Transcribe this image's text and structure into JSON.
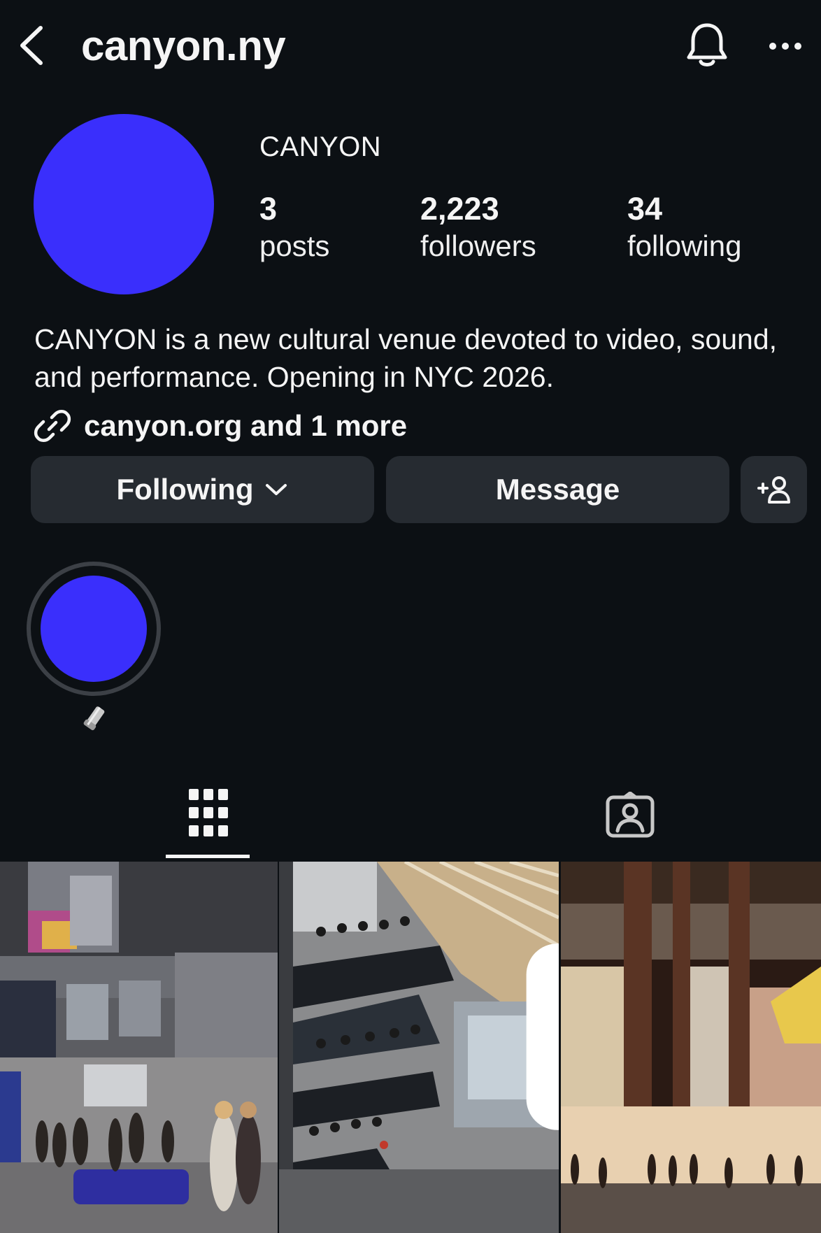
{
  "header": {
    "username": "canyon.ny",
    "back_icon": "chevron-left-icon",
    "bell_icon": "bell-icon",
    "more_icon": "ellipsis-icon"
  },
  "profile": {
    "display_name": "CANYON",
    "avatar_color": "#3a2ffc",
    "stats": [
      {
        "value": "3",
        "label": "posts"
      },
      {
        "value": "2,223",
        "label": "followers"
      },
      {
        "value": "34",
        "label": "following"
      }
    ],
    "bio": "CANYON is a new cultural venue devoted to video, sound, and performance. Opening in NYC 2026.",
    "link_text": "canyon.org and 1 more"
  },
  "actions": {
    "following_label": "Following",
    "message_label": "Message"
  },
  "highlight": {
    "color": "#3a2ffc",
    "label_icon": "horn-emoji-icon"
  },
  "tabs": {
    "active": "grid",
    "items": [
      "grid-icon",
      "tagged-icon"
    ]
  },
  "grid": {
    "tiles": [
      {
        "name": "post-interior-lobby"
      },
      {
        "name": "post-staircase-crowd",
        "carousel": true
      },
      {
        "name": "post-building-exterior"
      }
    ]
  },
  "colors": {
    "background": "#0c1014",
    "button": "#262b31",
    "accent": "#3a2ffc"
  }
}
